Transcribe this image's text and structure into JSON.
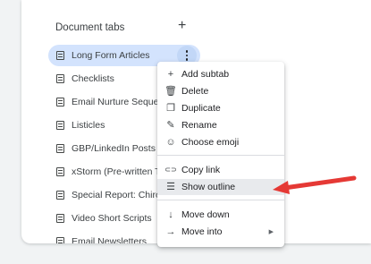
{
  "panel": {
    "title": "Document tabs",
    "add_icon": "+"
  },
  "tabs": [
    {
      "label": "Long Form Articles",
      "active": true
    },
    {
      "label": "Checklists"
    },
    {
      "label": "Email Nurture Sequence"
    },
    {
      "label": "Listicles"
    },
    {
      "label": "GBP/LinkedIn Posts"
    },
    {
      "label": "xStorm (Pre-written Twee"
    },
    {
      "label": "Special Report: Chiroprac"
    },
    {
      "label": "Video Short Scripts"
    },
    {
      "label": "Email Newsletters"
    }
  ],
  "menu": {
    "items": [
      {
        "label": "Add subtab",
        "icon": "plus-icon",
        "glyph": "+"
      },
      {
        "label": "Delete",
        "icon": "trash-icon",
        "glyph": "🗑"
      },
      {
        "label": "Duplicate",
        "icon": "duplicate-icon",
        "glyph": "❐"
      },
      {
        "label": "Rename",
        "icon": "pencil-icon",
        "glyph": "✎"
      },
      {
        "label": "Choose emoji",
        "icon": "emoji-icon",
        "glyph": "☺"
      },
      {
        "label": "Copy link",
        "icon": "link-icon",
        "glyph": "⊂⊃"
      },
      {
        "label": "Show outline",
        "icon": "outline-icon",
        "glyph": "☰",
        "highlighted": true
      },
      {
        "label": "Move down",
        "icon": "arrow-down-icon",
        "glyph": "↓"
      },
      {
        "label": "Move into",
        "icon": "move-into-icon",
        "glyph": "→",
        "submenu_glyph": "▶"
      }
    ]
  },
  "colors": {
    "active_tab": "#d3e3fd",
    "highlight": "#e8eaed",
    "annotation_arrow": "#e53935"
  }
}
